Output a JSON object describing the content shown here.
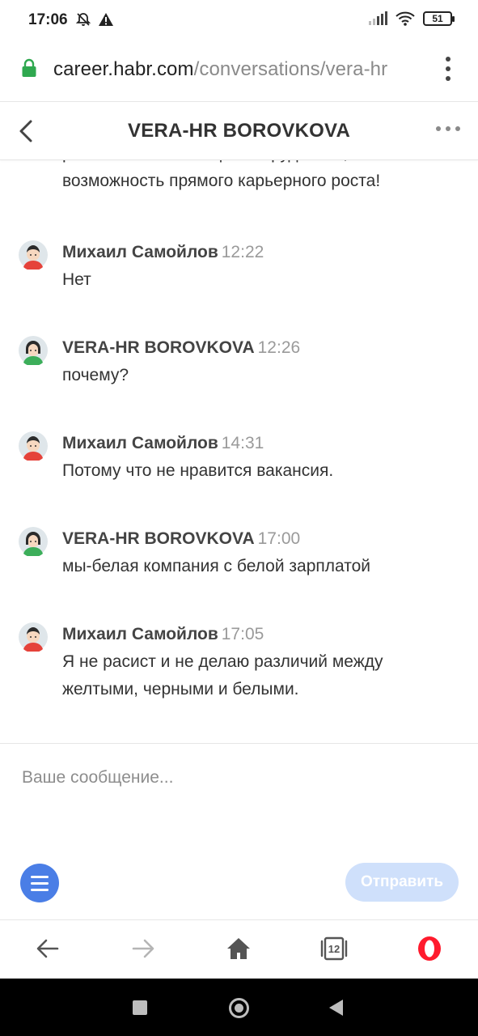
{
  "status_bar": {
    "time": "17:06",
    "battery": "51",
    "icons": [
      "mute-alarm-icon",
      "warning-icon",
      "signal-icon",
      "wifi-icon",
      "battery-icon"
    ]
  },
  "browser": {
    "url_host": "career.habr.com",
    "url_path": "/conversations/vera-hr",
    "tabs_count": "12",
    "accent_color": "#2fa84f"
  },
  "conversation": {
    "title": "VERA-HR BOROVKOVA",
    "partial_text": "развития и аттестации сотрудников,\nвозможность прямого карьерного роста!",
    "messages": [
      {
        "author": "Михаил Самойлов",
        "time": "12:22",
        "text": "Нет",
        "avatar": "male"
      },
      {
        "author": "VERA-HR BOROVKOVA",
        "time": "12:26",
        "text": "почему?",
        "avatar": "female"
      },
      {
        "author": "Михаил Самойлов",
        "time": "14:31",
        "text": "Потому что не нравится вакансия.",
        "avatar": "male"
      },
      {
        "author": "VERA-HR BOROVKOVA",
        "time": "17:00",
        "text": "мы-белая компания с белой зарплатой",
        "avatar": "female"
      },
      {
        "author": "Михаил Самойлов",
        "time": "17:05",
        "text": "Я не расист и не делаю различий между желтыми, черными и белыми.",
        "avatar": "male"
      }
    ]
  },
  "composer": {
    "placeholder": "Ваше сообщение...",
    "send_label": "Отправить",
    "menu_color": "#4a7ee6",
    "send_color": "#cfe0fb"
  }
}
